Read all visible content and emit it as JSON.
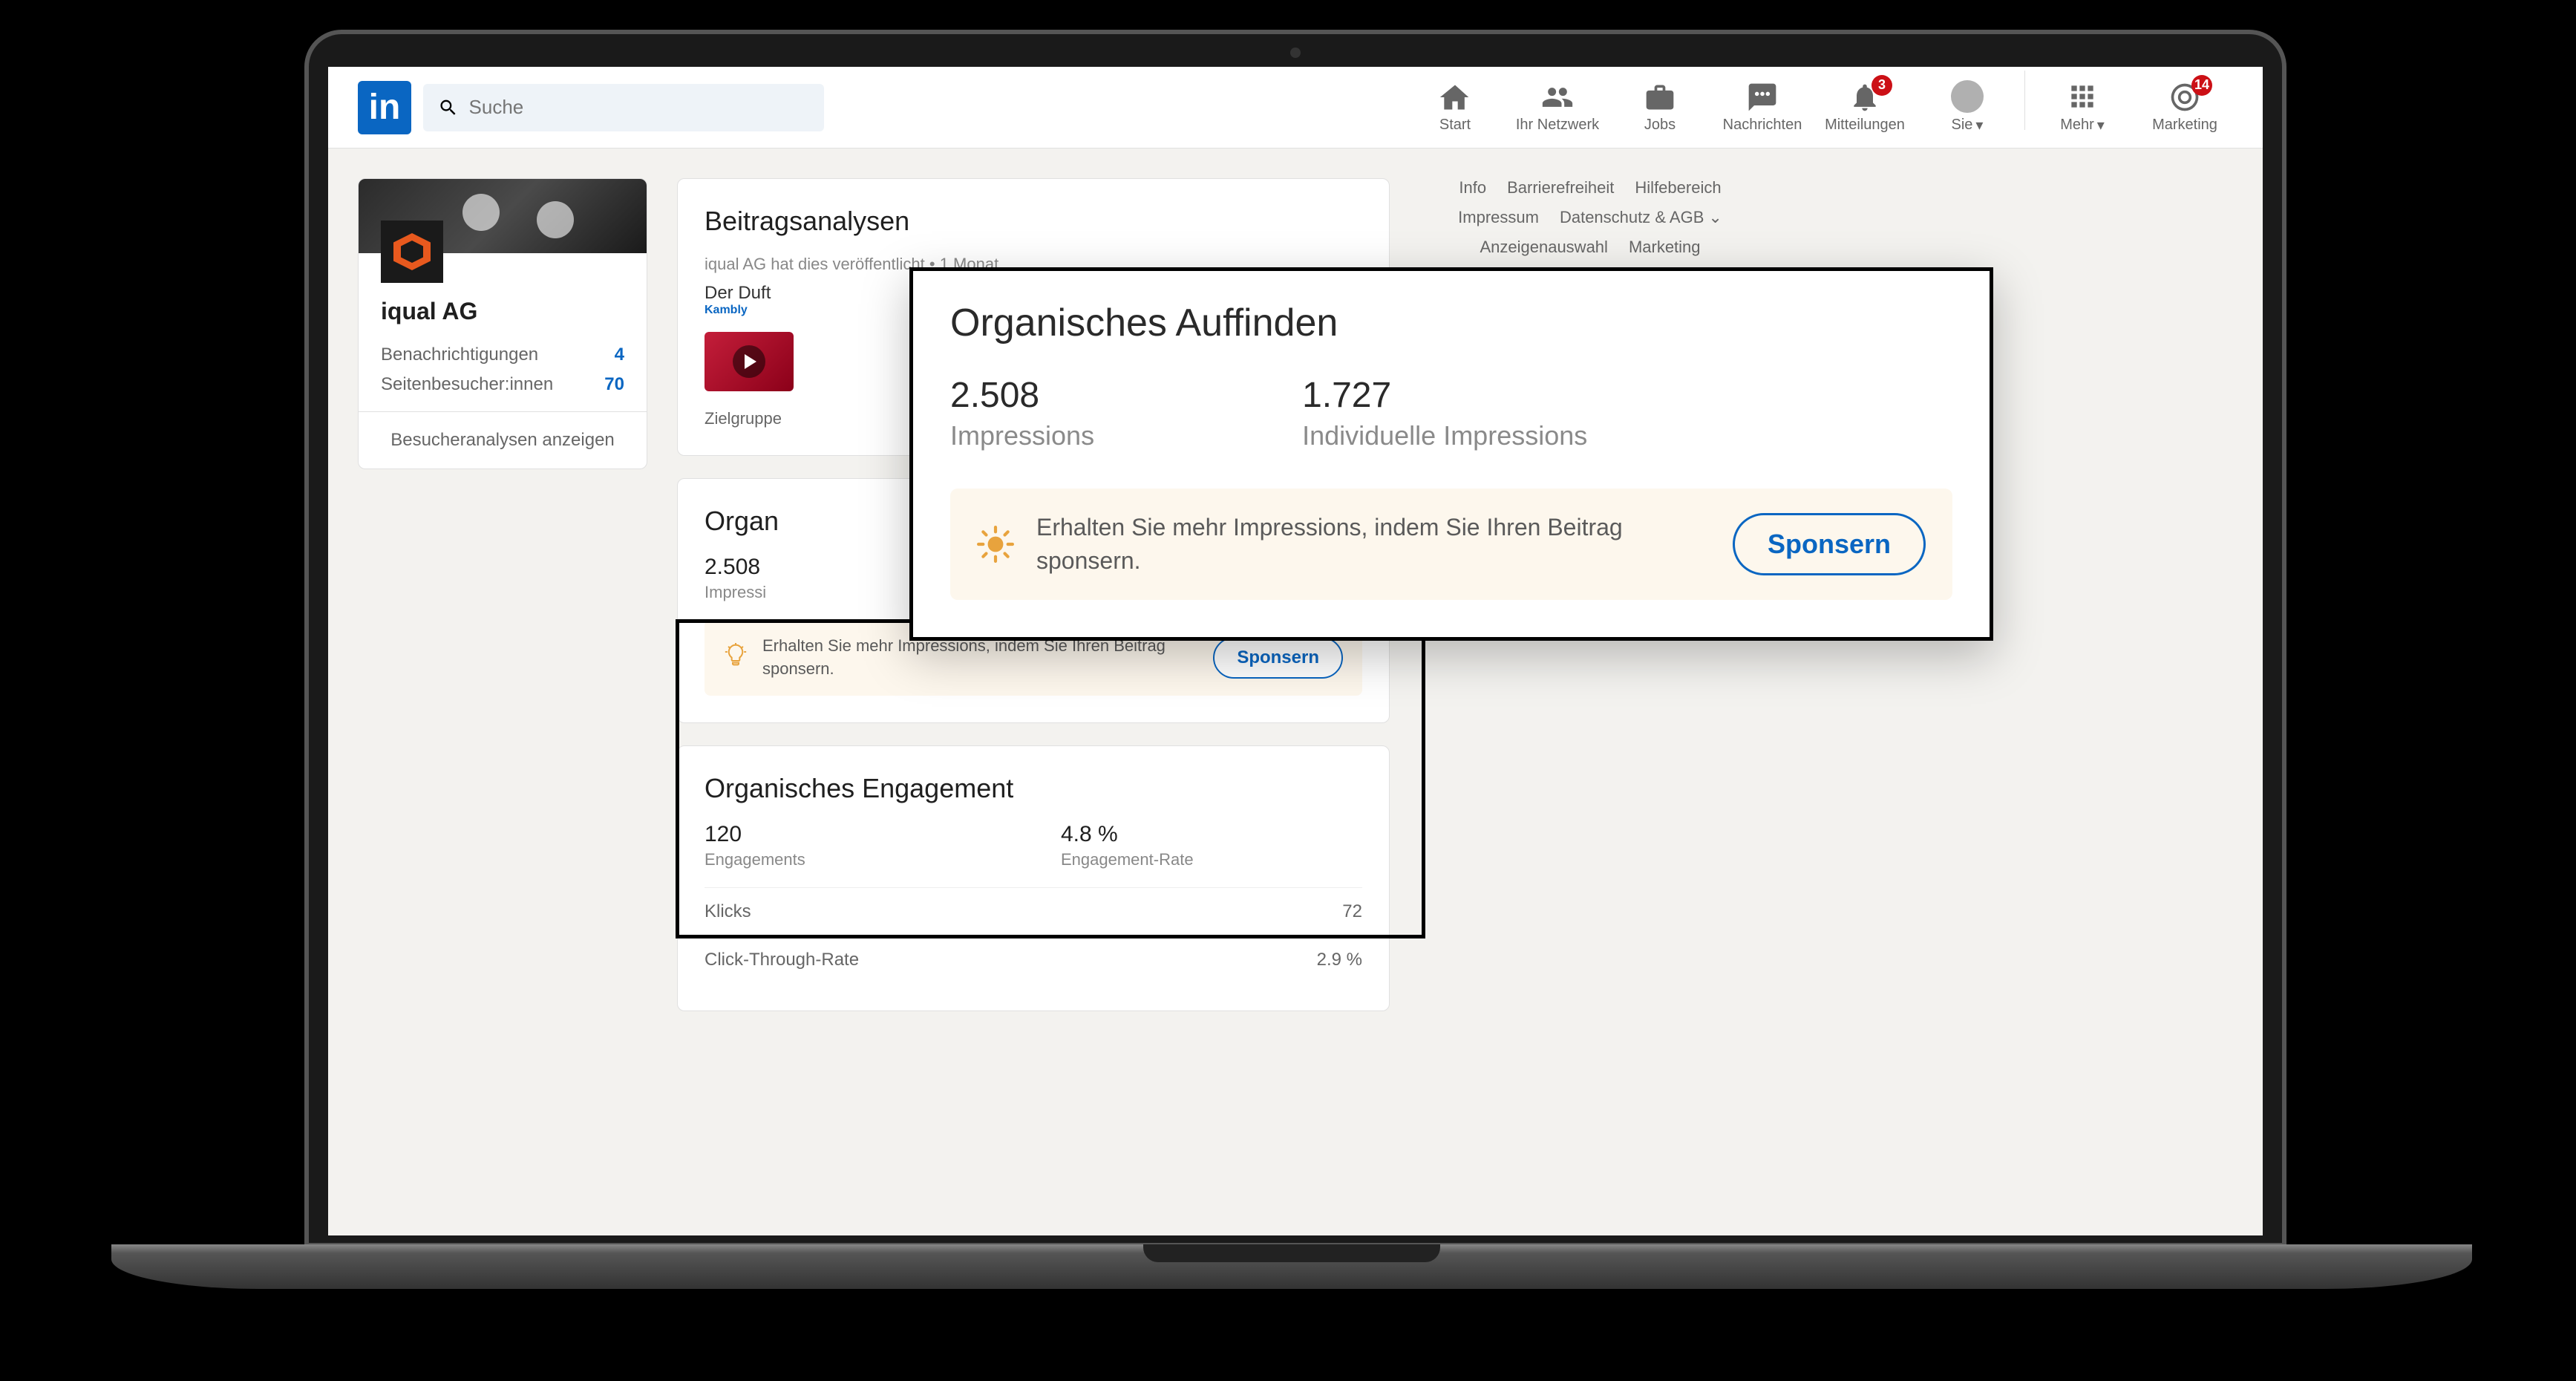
{
  "header": {
    "logo_text": "in",
    "search_placeholder": "Suche",
    "nav": {
      "start": "Start",
      "network": "Ihr Netzwerk",
      "jobs": "Jobs",
      "messages": "Nachrichten",
      "notifications": "Mitteilungen",
      "notifications_badge": "3",
      "you": "Sie",
      "more": "Mehr",
      "marketing": "Marketing",
      "marketing_badge": "14"
    }
  },
  "sidebar": {
    "company_name": "iqual AG",
    "rows": [
      {
        "label": "Benachrichtigungen",
        "value": "4"
      },
      {
        "label": "Seitenbesucher:innen",
        "value": "70"
      }
    ],
    "button": "Besucheranalysen anzeigen"
  },
  "post_card": {
    "title": "Beitragsanalysen",
    "meta": "iqual AG hat dies veröffentlicht • 1 Monat",
    "text_prefix": "Der Duft",
    "link_text": "Kambly",
    "zielgruppe": "Zielgruppe"
  },
  "organic_find": {
    "title": "Organisches Auffinden",
    "impressions_value": "2.508",
    "impressions_label": "Impressions",
    "unique_value": "1.727",
    "unique_label": "Individuelle Impressions",
    "promo_text": "Erhalten Sie mehr Impressions, indem Sie Ihren Beitrag sponsern.",
    "promo_button": "Sponsern"
  },
  "engagement": {
    "title": "Organisches Engagement",
    "engagements_value": "120",
    "engagements_label": "Engagements",
    "rate_value": "4.8 %",
    "rate_label": "Engagement-Rate",
    "lines": [
      {
        "label": "Klicks",
        "value": "72"
      },
      {
        "label": "Click-Through-Rate",
        "value": "2.9 %"
      }
    ]
  },
  "footer": {
    "links": [
      "Info",
      "Barrierefreiheit",
      "Hilfebereich",
      "Impressum",
      "Datenschutz & AGB",
      "Anzeigenauswahl",
      "Marketing"
    ]
  }
}
